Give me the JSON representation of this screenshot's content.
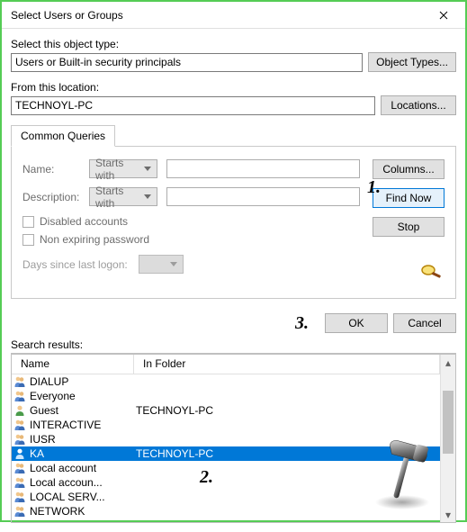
{
  "title": "Select Users or Groups",
  "object_type": {
    "label": "Select this object type:",
    "value": "Users or Built-in security principals",
    "button": "Object Types..."
  },
  "location": {
    "label": "From this location:",
    "value": "TECHNOYL-PC",
    "button": "Locations..."
  },
  "tab": "Common Queries",
  "queries": {
    "name_label": "Name:",
    "name_mode": "Starts with",
    "desc_label": "Description:",
    "desc_mode": "Starts with",
    "disabled": "Disabled accounts",
    "nonexp": "Non expiring password",
    "days": "Days since last logon:"
  },
  "buttons": {
    "columns": "Columns...",
    "find": "Find Now",
    "stop": "Stop",
    "ok": "OK",
    "cancel": "Cancel"
  },
  "search_label": "Search results:",
  "columns": {
    "name": "Name",
    "folder": "In Folder"
  },
  "results": [
    {
      "type": "group",
      "name": "DIALUP",
      "folder": ""
    },
    {
      "type": "group",
      "name": "Everyone",
      "folder": ""
    },
    {
      "type": "user",
      "name": "Guest",
      "folder": "TECHNOYL-PC"
    },
    {
      "type": "group",
      "name": "INTERACTIVE",
      "folder": ""
    },
    {
      "type": "group",
      "name": "IUSR",
      "folder": ""
    },
    {
      "type": "user",
      "name": "KA",
      "folder": "TECHNOYL-PC",
      "selected": true
    },
    {
      "type": "group",
      "name": "Local account",
      "folder": ""
    },
    {
      "type": "group",
      "name": "Local accoun...",
      "folder": ""
    },
    {
      "type": "group",
      "name": "LOCAL SERV...",
      "folder": ""
    },
    {
      "type": "group",
      "name": "NETWORK",
      "folder": ""
    }
  ],
  "annotations": {
    "a1": "1.",
    "a2": "2.",
    "a3": "3."
  }
}
